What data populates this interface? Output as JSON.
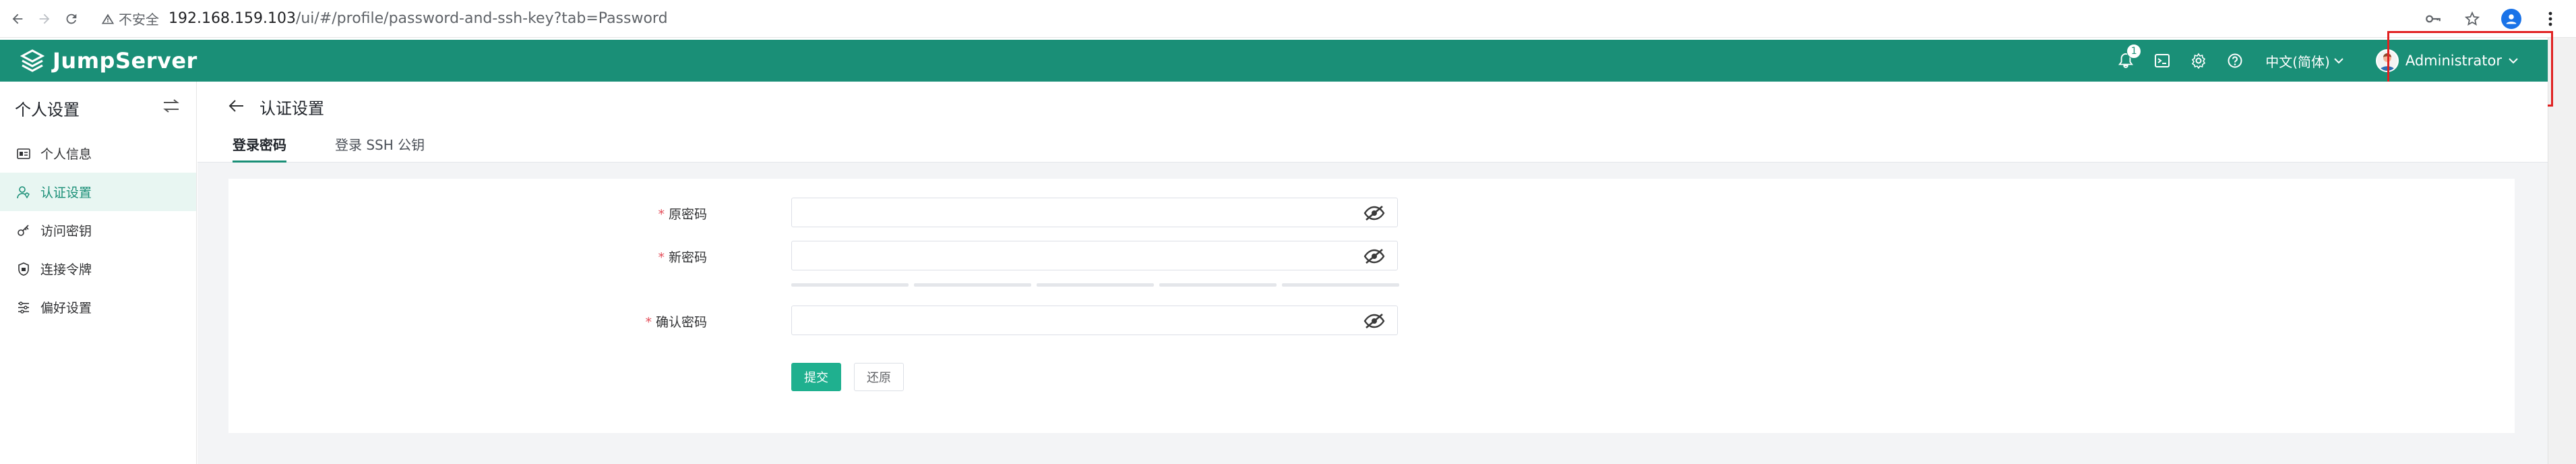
{
  "browser": {
    "insecure_label": "不安全",
    "url_host": "192.168.159.103",
    "url_path": "/ui/#/profile/password-and-ssh-key?tab=Password"
  },
  "header": {
    "logo_text": "JumpServer",
    "notification_count": "1",
    "language": "中文(简体)",
    "username": "Administrator",
    "brand_color": "#1a8f77"
  },
  "sidebar": {
    "title": "个人设置",
    "items": [
      {
        "label": "个人信息",
        "icon": "id-card-icon"
      },
      {
        "label": "认证设置",
        "icon": "user-shield-icon",
        "active": true
      },
      {
        "label": "访问密钥",
        "icon": "key-icon"
      },
      {
        "label": "连接令牌",
        "icon": "token-icon"
      },
      {
        "label": "偏好设置",
        "icon": "sliders-icon"
      }
    ]
  },
  "main": {
    "page_title": "认证设置",
    "tabs": [
      {
        "label": "登录密码",
        "active": true
      },
      {
        "label": "登录 SSH 公钥",
        "active": false
      }
    ],
    "form": {
      "old_password_label": "原密码",
      "new_password_label": "新密码",
      "confirm_password_label": "确认密码",
      "required_mark": "*",
      "submit_label": "提交",
      "reset_label": "还原"
    }
  }
}
